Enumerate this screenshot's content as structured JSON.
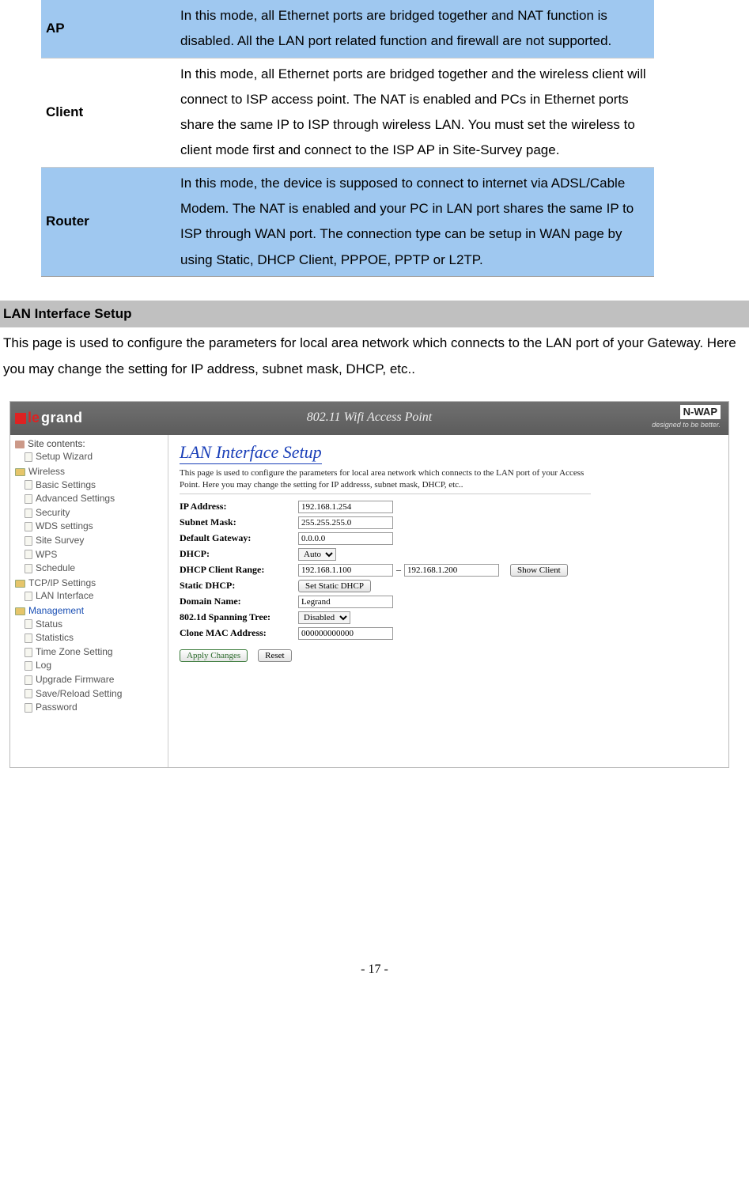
{
  "modes_table": {
    "rows": [
      {
        "label": "AP",
        "desc": "In this mode, all Ethernet ports are bridged together and NAT function is disabled. All the LAN port related function and firewall are not supported."
      },
      {
        "label": "Client",
        "desc": "In this mode, all Ethernet ports are bridged together and the wireless client will connect to ISP access point. The NAT is enabled and PCs in Ethernet ports share the same IP to ISP through wireless LAN. You must set the wireless to client mode first and connect to the ISP AP in Site-Survey page."
      },
      {
        "label": "Router",
        "desc": "In this mode, the device is supposed to connect to internet via ADSL/Cable Modem. The NAT is enabled and your PC in LAN port shares the same IP to ISP through WAN port. The connection type can be setup in WAN page by using Static, DHCP Client, PPPOE, PPTP or L2TP."
      }
    ]
  },
  "section": {
    "title": "LAN Interface Setup",
    "body": "This page is used to configure the parameters for local area network which connects to the LAN port of your Gateway. Here you may change the setting for IP address, subnet mask, DHCP, etc.."
  },
  "screenshot": {
    "header": {
      "brand1": "le",
      "brand2": "grand",
      "title": "802.11 Wifi Access Point",
      "nwap": "N-WAP",
      "tagline": "designed to be better."
    },
    "sidebar": {
      "title": "Site contents:",
      "items": {
        "setup_wizard": "Setup Wizard",
        "wireless": "Wireless",
        "wireless_children": [
          "Basic Settings",
          "Advanced Settings",
          "Security",
          "WDS settings",
          "Site Survey",
          "WPS",
          "Schedule"
        ],
        "tcpip": "TCP/IP Settings",
        "tcpip_children": [
          "LAN Interface"
        ],
        "management": "Management",
        "management_children": [
          "Status",
          "Statistics",
          "Time Zone Setting",
          "Log",
          "Upgrade Firmware",
          "Save/Reload Setting",
          "Password"
        ]
      }
    },
    "main": {
      "title": "LAN Interface Setup",
      "desc": "This page is used to configure the parameters for local area network which connects to the LAN port of your Access Point. Here you may change the setting for IP addresss, subnet mask, DHCP, etc..",
      "fields": {
        "ip": {
          "label": "IP Address:",
          "value": "192.168.1.254"
        },
        "mask": {
          "label": "Subnet Mask:",
          "value": "255.255.255.0"
        },
        "gw": {
          "label": "Default Gateway:",
          "value": "0.0.0.0"
        },
        "dhcp": {
          "label": "DHCP:",
          "value": "Auto"
        },
        "range": {
          "label": "DHCP Client Range:",
          "from": "192.168.1.100",
          "to": "192.168.1.200",
          "btn": "Show Client"
        },
        "static": {
          "label": "Static DHCP:",
          "btn": "Set Static DHCP"
        },
        "domain": {
          "label": "Domain Name:",
          "value": "Legrand"
        },
        "stp": {
          "label": "802.1d Spanning Tree:",
          "value": "Disabled"
        },
        "clone": {
          "label": "Clone MAC Address:",
          "value": "000000000000"
        }
      },
      "buttons": {
        "apply": "Apply Changes",
        "reset": "Reset"
      }
    }
  },
  "page_number": "- 17 -"
}
